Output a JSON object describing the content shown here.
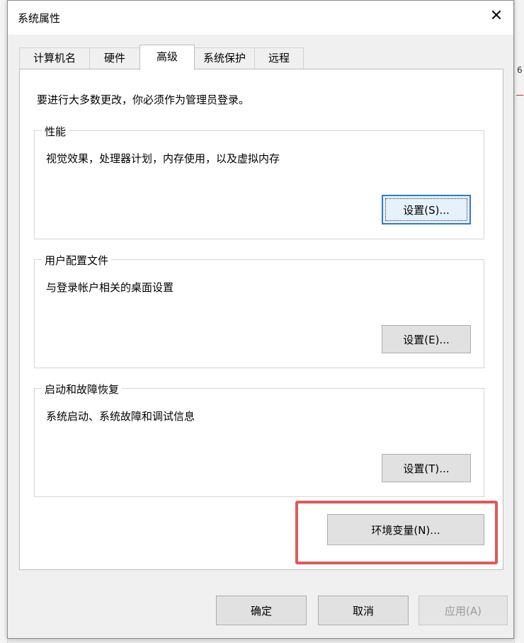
{
  "window": {
    "title": "系统属性",
    "close_glyph": "✕"
  },
  "tabs": [
    {
      "label": "计算机名",
      "active": false
    },
    {
      "label": "硬件",
      "active": false
    },
    {
      "label": "高级",
      "active": true
    },
    {
      "label": "系统保护",
      "active": false
    },
    {
      "label": "远程",
      "active": false
    }
  ],
  "advanced": {
    "admin_notice": "要进行大多数更改，你必须作为管理员登录。",
    "performance": {
      "legend": "性能",
      "description": "视觉效果，处理器计划，内存使用，以及虚拟内存",
      "button_label": "设置(S)..."
    },
    "user_profiles": {
      "legend": "用户配置文件",
      "description": "与登录帐户相关的桌面设置",
      "button_label": "设置(E)..."
    },
    "startup_recovery": {
      "legend": "启动和故障恢复",
      "description": "系统启动、系统故障和调试信息",
      "button_label": "设置(T)..."
    },
    "env_button_label": "环境变量(N)..."
  },
  "footer": {
    "ok_label": "确定",
    "cancel_label": "取消",
    "apply_label": "应用(A)"
  },
  "background": {
    "right_edge_digit": "6"
  },
  "colors": {
    "highlight": "#e05a5a",
    "focus": "#2f7bd3"
  }
}
